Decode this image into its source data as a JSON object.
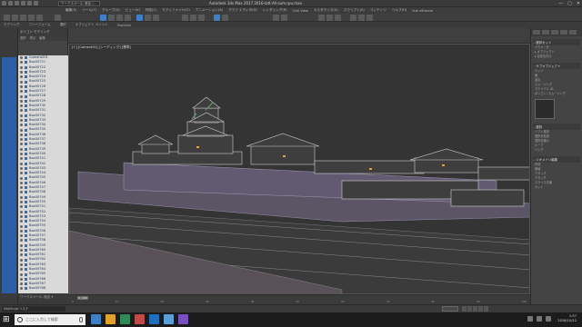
{
  "window": {
    "title": "Autodesk 3ds Max 2017    2016-latt-All-sum.rpu.max",
    "workspace": "ワークスペース: 既定 (...",
    "controls": [
      "—",
      "▢",
      "✕"
    ]
  },
  "menu": [
    "編集(E)",
    "ツール(T)",
    "グループ(G)",
    "ビュー(V)",
    "作成(C)",
    "モディファイヤ(O)",
    "アニメーション(A)",
    "グラフ エディタ(D)",
    "レンダリング(R)",
    "Civil View",
    "カスタマイズ(U)",
    "スクリプト(S)",
    "コンテンツ",
    "ヘルプ(H)",
    "Vue xStream"
  ],
  "ribbon": [
    "モデリング",
    "フリーフォーム",
    "選択",
    "オブジェクト ペイント",
    "Populate"
  ],
  "explorer": {
    "header": "ポリゴン モデリング",
    "tabs": [
      "選択",
      "表示",
      "編集"
    ],
    "rows": [
      "Camera001",
      "Box00721",
      "Box00722",
      "Box00723",
      "Box00724",
      "Box00725",
      "Box00726",
      "Box00727",
      "Box00728",
      "Box00729",
      "Box00730",
      "Box00731",
      "Box00732",
      "Box00733",
      "Box00734",
      "Box00735",
      "Box00736",
      "Box00737",
      "Box00738",
      "Box00739",
      "Box00740",
      "Box00741",
      "Box00742",
      "Box00743",
      "Box00744",
      "Box00745",
      "Box00746",
      "Box00747",
      "Box00748",
      "Box00749",
      "Box00750",
      "Box00751",
      "Box00752",
      "Box00753",
      "Box00754",
      "Box00755",
      "Box00756",
      "Box00757",
      "Box00758",
      "Box00759",
      "Box00760",
      "Box00761",
      "Box00762",
      "Box00763",
      "Box00764",
      "Box00765",
      "Box00766",
      "Box00767",
      "Box00768"
    ],
    "footer": "ワークスペース: 既定 ▾"
  },
  "viewport": {
    "label": "[+] [Camera01] [シーディング] [標準]"
  },
  "cmdpanel": {
    "sections": [
      {
        "h": "- 選択セット",
        "items": [
          "パラメータ",
          "▸ オブジェクト",
          "▸ 名前を付け"
        ]
      },
      {
        "h": "- サブオブジェクト",
        "items": [
          "エッジ",
          "面",
          "頂点",
          "スムージング",
          "マテリアル ID",
          "ポリゴン: スムージング"
        ]
      },
      {
        "h": "- 選択",
        "items": [
          "ソフト選択",
          "選択を拡張",
          "選択を縮小",
          "ループ",
          "リング"
        ]
      },
      {
        "h": "- ジオメトリ編集",
        "items": [
          "作成",
          "崩壊",
          "アタッチ",
          "デタッチ",
          "スライス平面",
          "カット"
        ]
      }
    ]
  },
  "timeline": {
    "slider": "0 / 100",
    "ticks": [
      "0",
      "10",
      "20",
      "30",
      "40",
      "50",
      "60",
      "70",
      "80",
      "90",
      "100"
    ]
  },
  "statusbar": {
    "maxscript": "MAXScript リスナ"
  },
  "taskbar": {
    "search_placeholder": "ここに入力して検索",
    "time": "1:57",
    "date": "2016/10/12",
    "app_colors": [
      "#3f7fc4",
      "#e0a02a",
      "#2e8b57",
      "#c04a4a",
      "#1f6fbf",
      "#5aa0d8",
      "#7a4fc0"
    ]
  }
}
